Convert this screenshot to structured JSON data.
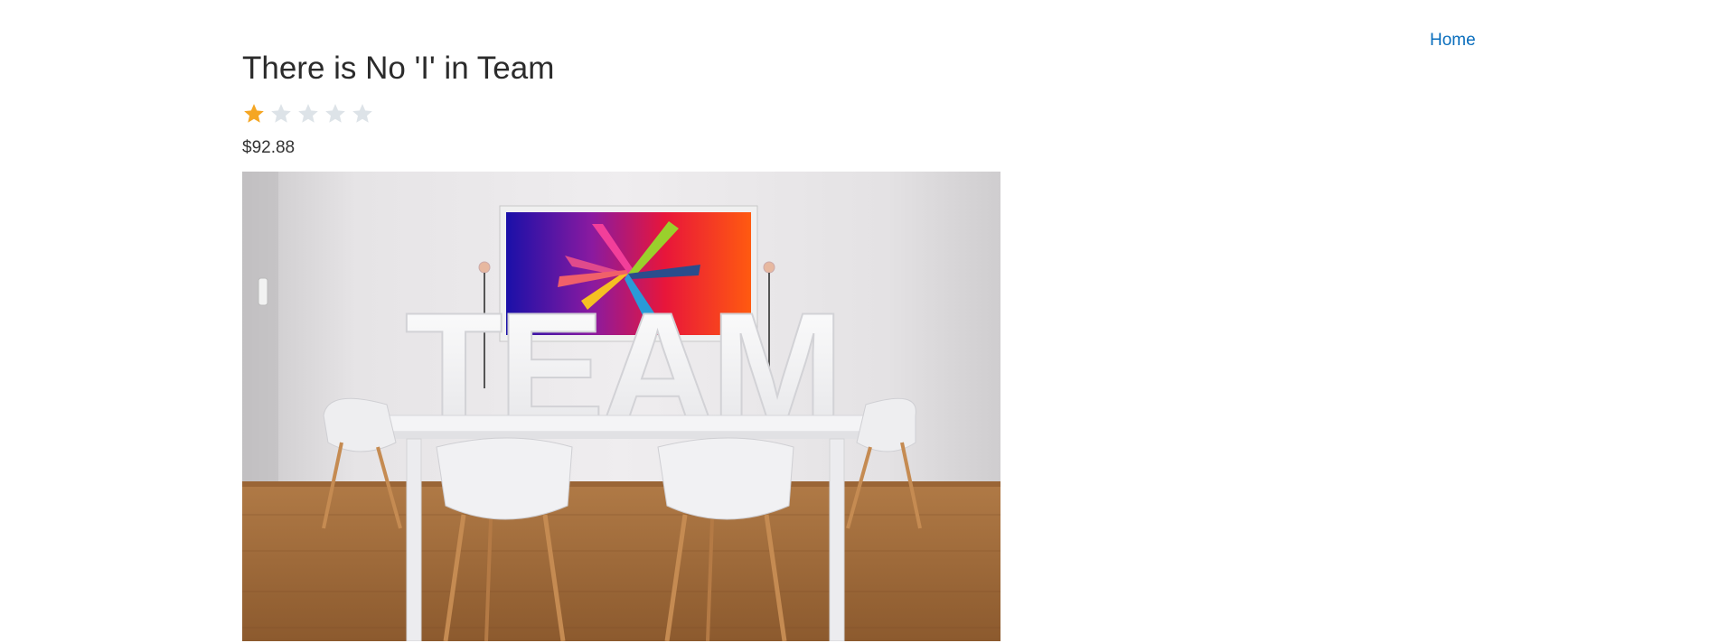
{
  "nav": {
    "home_label": "Home"
  },
  "product": {
    "title": "There is No 'I' in Team",
    "rating": {
      "value": 1,
      "max": 5
    },
    "price": "$92.88",
    "image": {
      "label": "TEAM"
    }
  },
  "colors": {
    "link": "#0a6ebd",
    "star_filled": "#f5a623",
    "star_empty": "#dde3e8",
    "text": "#333333"
  }
}
